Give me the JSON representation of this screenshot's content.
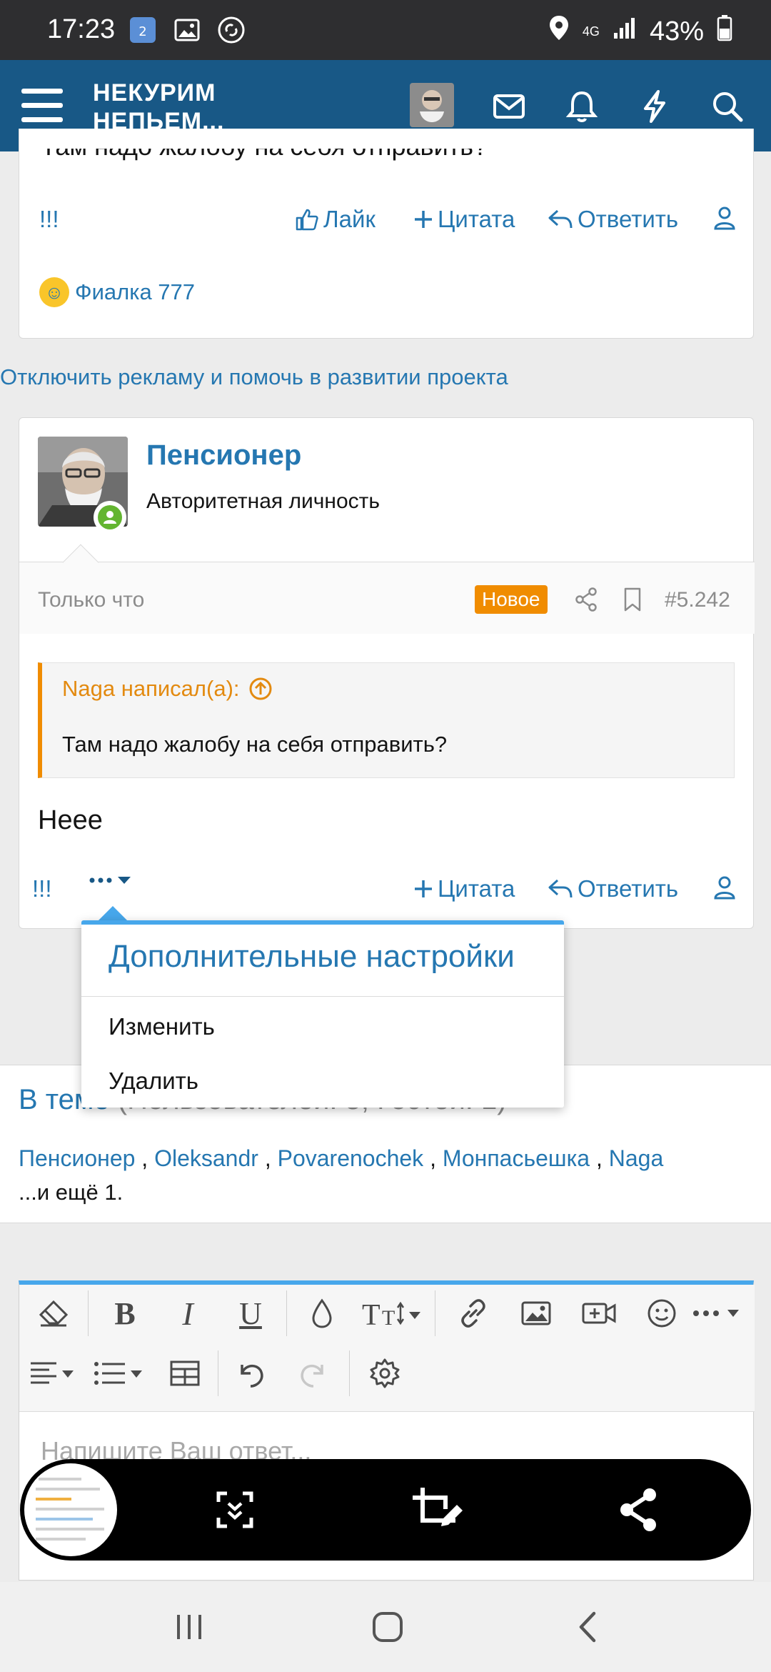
{
  "status_bar": {
    "time": "17:23",
    "battery": "43%",
    "network": "4G"
  },
  "app_bar": {
    "logo_line1": "НЕКУРИМ",
    "logo_line2": "НЕПЬЕМ..."
  },
  "previous_post": {
    "text": "Там надо жалобу на себя отправить?",
    "report": "!!!",
    "like": "Лайк",
    "quote": "Цитата",
    "reply": "Ответить",
    "reaction_user": "Фиалка 777"
  },
  "ad_link": "Отключить рекламу и помочь в развитии проекта",
  "post": {
    "username": "Пенсионер",
    "user_title": "Авторитетная личность",
    "time": "Только что",
    "badge": "Новое",
    "post_number": "#5.242",
    "quote_author": "Naga написал(а):",
    "quote_text": "Там надо жалобу на себя отправить?",
    "message": "Неее",
    "report": "!!!",
    "quote": "Цитата",
    "reply": "Ответить"
  },
  "popup": {
    "title": "Дополнительные настройки",
    "items": [
      "Изменить",
      "Удалить"
    ]
  },
  "thread": {
    "title": "В теме",
    "subtitle": " (Пользователей: 5, Гостей: 1)",
    "users": [
      "Пенсионер",
      "Oleksandr",
      "Povarenochek",
      "Монпасьешка",
      "Naga"
    ],
    "more": "...и ещё 1."
  },
  "editor": {
    "placeholder": "Напишите Ваш ответ..."
  },
  "colors": {
    "brand": "#185886",
    "link": "#2577b1",
    "accent": "#f08c00",
    "online": "#63b530"
  }
}
